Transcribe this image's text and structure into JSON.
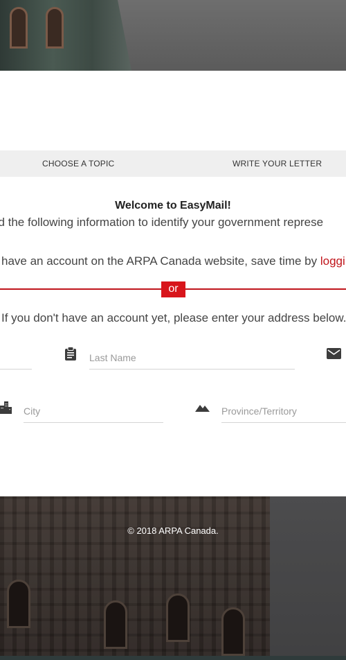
{
  "tabs": {
    "choose_topic": "CHOOSE A TOPIC",
    "write_letter": "WRITE YOUR LETTER"
  },
  "intro": {
    "welcome": "Welcome to EasyMail!",
    "need_info": "ed the following information to identify your government represe",
    "account_text": "have an account on the ARPA Canada website, save time by ",
    "login_link": "loggi",
    "or_label": "or",
    "no_account_text": "If you don't have an account yet, please enter your address below."
  },
  "form": {
    "last_name_placeholder": "Last Name",
    "city_placeholder": "City",
    "province_placeholder": "Province/Territory"
  },
  "footer": {
    "copyright": "© 2018 ARPA Canada."
  },
  "colors": {
    "accent": "#c0151b",
    "tab_bar": "#efefef"
  }
}
